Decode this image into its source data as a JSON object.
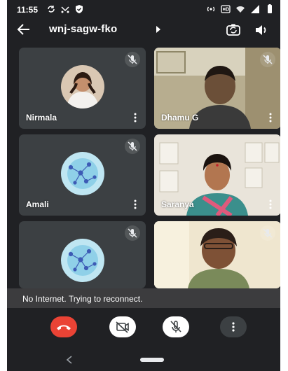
{
  "status_bar": {
    "time": "11:55",
    "icons": [
      "sync-icon",
      "missed-call-icon",
      "shield-icon",
      "hotspot-icon",
      "hd-icon",
      "wifi-icon",
      "signal-icon",
      "battery-icon"
    ]
  },
  "top_bar": {
    "meeting_code": "wnj-sagw-fko",
    "icons": [
      "back-arrow-icon",
      "caret-right-icon",
      "switch-camera-icon",
      "speaker-icon"
    ]
  },
  "participants": [
    {
      "name": "Nirmala",
      "muted": true,
      "view": "avatar-photo"
    },
    {
      "name": "Dhamu G",
      "muted": true,
      "view": "video"
    },
    {
      "name": "Amali",
      "muted": true,
      "view": "avatar-graphic"
    },
    {
      "name": "Saranya",
      "muted": false,
      "view": "video"
    },
    {
      "name": "",
      "muted": true,
      "view": "avatar-graphic"
    },
    {
      "name": "",
      "muted": true,
      "view": "video"
    }
  ],
  "snackbar": {
    "message": "No Internet. Trying to reconnect."
  },
  "controls": {
    "icons": [
      "end-call-icon",
      "camera-off-icon",
      "mic-off-icon",
      "more-vert-icon"
    ],
    "colors": {
      "end_call": "#ea4335",
      "toggle_bg": "#ffffff",
      "more_bg": "#3c4043"
    }
  },
  "colors": {
    "background": "#202124",
    "tile": "#3c4043",
    "snackbar": "#3c3c3e"
  }
}
